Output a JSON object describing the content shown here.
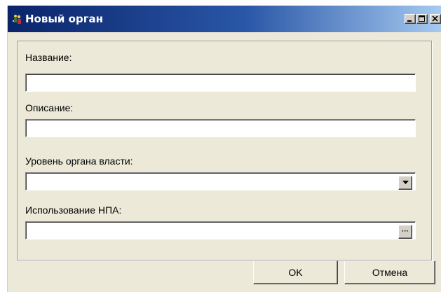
{
  "window": {
    "title": "Новый орган",
    "icon": "people-icon"
  },
  "form": {
    "name_label": "Название:",
    "name_value": "",
    "description_label": "Описание:",
    "description_value": "",
    "level_label": "Уровень  органа власти:",
    "level_selected": "",
    "npa_label": "Использование НПА:",
    "npa_value": "",
    "npa_browse": "···"
  },
  "buttons": {
    "ok": "OK",
    "cancel": "Отмена"
  },
  "colors": {
    "title_start": "#0a246a",
    "title_end": "#a6caf0",
    "dialog_bg": "#ece9d8"
  }
}
